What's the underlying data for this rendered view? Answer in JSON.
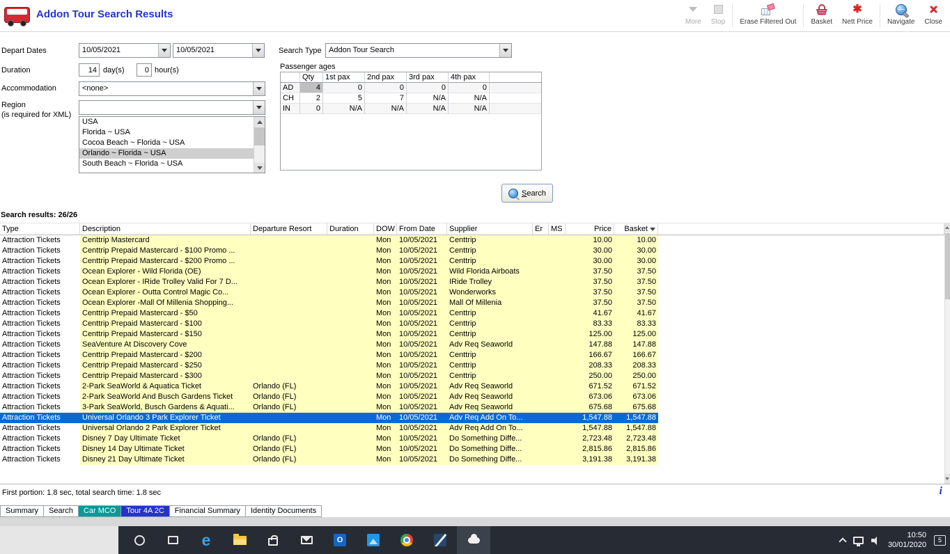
{
  "window": {
    "title": "Addon Tour Search Results"
  },
  "toolbar": {
    "buttons": [
      {
        "label": "More",
        "icon": "chevron-down-icon",
        "disabled": true
      },
      {
        "label": "Stop",
        "icon": "stop-icon",
        "disabled": true
      },
      {
        "label": "Erase Filtered Out",
        "icon": "erase-filter-icon",
        "disabled": false
      },
      {
        "label": "Basket",
        "icon": "basket-icon",
        "disabled": false
      },
      {
        "label": "Nett Price",
        "icon": "nett-price-icon",
        "disabled": false
      },
      {
        "label": "Navigate",
        "icon": "navigate-globe-icon",
        "disabled": false
      },
      {
        "label": "Close",
        "icon": "close-x-icon",
        "disabled": false
      }
    ]
  },
  "form": {
    "depart_dates_label": "Depart Dates",
    "depart_date_start": "10/05/2021",
    "depart_date_end": "10/05/2021",
    "duration_label": "Duration",
    "duration_days": "14",
    "days_suffix": "day(s)",
    "duration_hours": "0",
    "hours_suffix": "hour(s)",
    "accommodation_label": "Accommodation",
    "accommodation_value": "<none>",
    "region_label": "Region",
    "region_note": "(is required for XML)",
    "region_value": "",
    "region_options": [
      "USA",
      "Florida ~ USA",
      "Cocoa Beach ~ Florida ~ USA",
      "Orlando ~ Florida ~ USA",
      "South Beach ~ Florida ~ USA"
    ],
    "region_selected": "Orlando ~ Florida ~ USA",
    "search_type_label": "Search Type",
    "search_type_value": "Addon Tour Search",
    "passenger_ages_label": "Passenger ages",
    "passenger_headers": [
      "Qty",
      "1st pax",
      "2nd pax",
      "3rd pax",
      "4th pax"
    ],
    "passenger_rows": [
      {
        "label": "AD",
        "qty": "4",
        "pax": [
          "0",
          "0",
          "0",
          "0"
        ]
      },
      {
        "label": "CH",
        "qty": "2",
        "pax": [
          "5",
          "7",
          "N/A",
          "N/A"
        ]
      },
      {
        "label": "IN",
        "qty": "0",
        "pax": [
          "N/A",
          "N/A",
          "N/A",
          "N/A"
        ]
      }
    ],
    "search_button_label": "Search"
  },
  "results": {
    "summary_label": "Search results: 26/26",
    "columns": [
      "Type",
      "Description",
      "Departure Resort",
      "Duration",
      "DOW",
      "From Date",
      "Supplier",
      "Er",
      "MS",
      "Price",
      "Basket"
    ],
    "rows": [
      {
        "type": "Attraction Tickets",
        "description": "Centtrip Mastercard",
        "resort": "",
        "duration": "",
        "dow": "Mon",
        "from_date": "10/05/2021",
        "supplier": "Centtrip",
        "price": "10.00",
        "basket": "10.00"
      },
      {
        "type": "Attraction Tickets",
        "description": "Centtrip Prepaid Mastercard - $100 Promo ...",
        "resort": "",
        "duration": "",
        "dow": "Mon",
        "from_date": "10/05/2021",
        "supplier": "Centtrip",
        "price": "30.00",
        "basket": "30.00"
      },
      {
        "type": "Attraction Tickets",
        "description": "Centtrip Prepaid Mastercard - $200 Promo ...",
        "resort": "",
        "duration": "",
        "dow": "Mon",
        "from_date": "10/05/2021",
        "supplier": "Centtrip",
        "price": "30.00",
        "basket": "30.00"
      },
      {
        "type": "Attraction Tickets",
        "description": "Ocean Explorer - Wild Florida (OE)",
        "resort": "",
        "duration": "",
        "dow": "Mon",
        "from_date": "10/05/2021",
        "supplier": "Wild Florida Airboats",
        "price": "37.50",
        "basket": "37.50"
      },
      {
        "type": "Attraction Tickets",
        "description": "Ocean Explorer - IRide Trolley Valid For 7 D...",
        "resort": "",
        "duration": "",
        "dow": "Mon",
        "from_date": "10/05/2021",
        "supplier": "IRide Trolley",
        "price": "37.50",
        "basket": "37.50"
      },
      {
        "type": "Attraction Tickets",
        "description": "Ocean Explorer - Outta Control Magic Co...",
        "resort": "",
        "duration": "",
        "dow": "Mon",
        "from_date": "10/05/2021",
        "supplier": "Wonderworks",
        "price": "37.50",
        "basket": "37.50"
      },
      {
        "type": "Attraction Tickets",
        "description": "Ocean Explorer -Mall Of Millenia Shopping...",
        "resort": "",
        "duration": "",
        "dow": "Mon",
        "from_date": "10/05/2021",
        "supplier": "Mall Of Millenia",
        "price": "37.50",
        "basket": "37.50"
      },
      {
        "type": "Attraction Tickets",
        "description": "Centtrip Prepaid Mastercard - $50",
        "resort": "",
        "duration": "",
        "dow": "Mon",
        "from_date": "10/05/2021",
        "supplier": "Centtrip",
        "price": "41.67",
        "basket": "41.67"
      },
      {
        "type": "Attraction Tickets",
        "description": "Centtrip Prepaid Mastercard - $100",
        "resort": "",
        "duration": "",
        "dow": "Mon",
        "from_date": "10/05/2021",
        "supplier": "Centtrip",
        "price": "83.33",
        "basket": "83.33"
      },
      {
        "type": "Attraction Tickets",
        "description": "Centtrip Prepaid Mastercard - $150",
        "resort": "",
        "duration": "",
        "dow": "Mon",
        "from_date": "10/05/2021",
        "supplier": "Centtrip",
        "price": "125.00",
        "basket": "125.00"
      },
      {
        "type": "Attraction Tickets",
        "description": "SeaVenture At Discovery Cove",
        "resort": "",
        "duration": "",
        "dow": "Mon",
        "from_date": "10/05/2021",
        "supplier": "Adv Req Seaworld",
        "price": "147.88",
        "basket": "147.88"
      },
      {
        "type": "Attraction Tickets",
        "description": "Centtrip Prepaid Mastercard - $200",
        "resort": "",
        "duration": "",
        "dow": "Mon",
        "from_date": "10/05/2021",
        "supplier": "Centtrip",
        "price": "166.67",
        "basket": "166.67"
      },
      {
        "type": "Attraction Tickets",
        "description": "Centtrip Prepaid Mastercard - $250",
        "resort": "",
        "duration": "",
        "dow": "Mon",
        "from_date": "10/05/2021",
        "supplier": "Centtrip",
        "price": "208.33",
        "basket": "208.33"
      },
      {
        "type": "Attraction Tickets",
        "description": "Centtrip Prepaid Mastercard - $300",
        "resort": "",
        "duration": "",
        "dow": "Mon",
        "from_date": "10/05/2021",
        "supplier": "Centtrip",
        "price": "250.00",
        "basket": "250.00"
      },
      {
        "type": "Attraction Tickets",
        "description": "2-Park SeaWorld & Aquatica Ticket",
        "resort": "Orlando (FL)",
        "duration": "",
        "dow": "Mon",
        "from_date": "10/05/2021",
        "supplier": "Adv Req Seaworld",
        "price": "671.52",
        "basket": "671.52"
      },
      {
        "type": "Attraction Tickets",
        "description": "2-Park SeaWorld And Busch Gardens Ticket",
        "resort": "Orlando (FL)",
        "duration": "",
        "dow": "Mon",
        "from_date": "10/05/2021",
        "supplier": "Adv Req Seaworld",
        "price": "673.06",
        "basket": "673.06"
      },
      {
        "type": "Attraction Tickets",
        "description": "3-Park SeaWorld, Busch Gardens & Aquati...",
        "resort": "Orlando (FL)",
        "duration": "",
        "dow": "Mon",
        "from_date": "10/05/2021",
        "supplier": "Adv Req Seaworld",
        "price": "675.68",
        "basket": "675.68"
      },
      {
        "type": "Attraction Tickets",
        "description": "Universal Orlando 3 Park Explorer Ticket",
        "resort": "",
        "duration": "",
        "dow": "Mon",
        "from_date": "10/05/2021",
        "supplier": "Adv Req Add On To...",
        "price": "1,547.88",
        "basket": "1,547.88",
        "selected": true
      },
      {
        "type": "Attraction Tickets",
        "description": "Universal Orlando 2 Park Explorer Ticket",
        "resort": "",
        "duration": "",
        "dow": "Mon",
        "from_date": "10/05/2021",
        "supplier": "Adv Req Add On To...",
        "price": "1,547.88",
        "basket": "1,547.88"
      },
      {
        "type": "Attraction Tickets",
        "description": "Disney 7 Day Ultimate Ticket",
        "resort": "Orlando (FL)",
        "duration": "",
        "dow": "Mon",
        "from_date": "10/05/2021",
        "supplier": "Do Something Diffe...",
        "price": "2,723.48",
        "basket": "2,723.48"
      },
      {
        "type": "Attraction Tickets",
        "description": "Disney 14 Day Ultimate Ticket",
        "resort": "Orlando (FL)",
        "duration": "",
        "dow": "Mon",
        "from_date": "10/05/2021",
        "supplier": "Do Something Diffe...",
        "price": "2,815.86",
        "basket": "2,815.86"
      },
      {
        "type": "Attraction Tickets",
        "description": "Disney 21 Day Ultimate Ticket",
        "resort": "Orlando (FL)",
        "duration": "",
        "dow": "Mon",
        "from_date": "10/05/2021",
        "supplier": "Do Something Diffe...",
        "price": "3,191.38",
        "basket": "3,191.38"
      }
    ]
  },
  "status": {
    "text": "First portion: 1.8 sec, total search time: 1.8 sec",
    "info": "i"
  },
  "tabs": [
    {
      "label": "Summary",
      "style": "normal"
    },
    {
      "label": "Search",
      "style": "normal"
    },
    {
      "label": "Car MCO",
      "style": "teal"
    },
    {
      "label": "Tour 4A 2C",
      "style": "active"
    },
    {
      "label": "Financial Summary",
      "style": "normal"
    },
    {
      "label": "Identity Documents",
      "style": "normal"
    }
  ],
  "taskbar": {
    "apps": [
      "cortana-search",
      "task-view",
      "edge",
      "file-explorer",
      "store",
      "mail",
      "outlook",
      "photos",
      "chrome",
      "blue-app",
      "travel-app-active"
    ],
    "tray": {
      "time": "10:50",
      "date": "30/01/2020",
      "notification_count": "5"
    }
  }
}
